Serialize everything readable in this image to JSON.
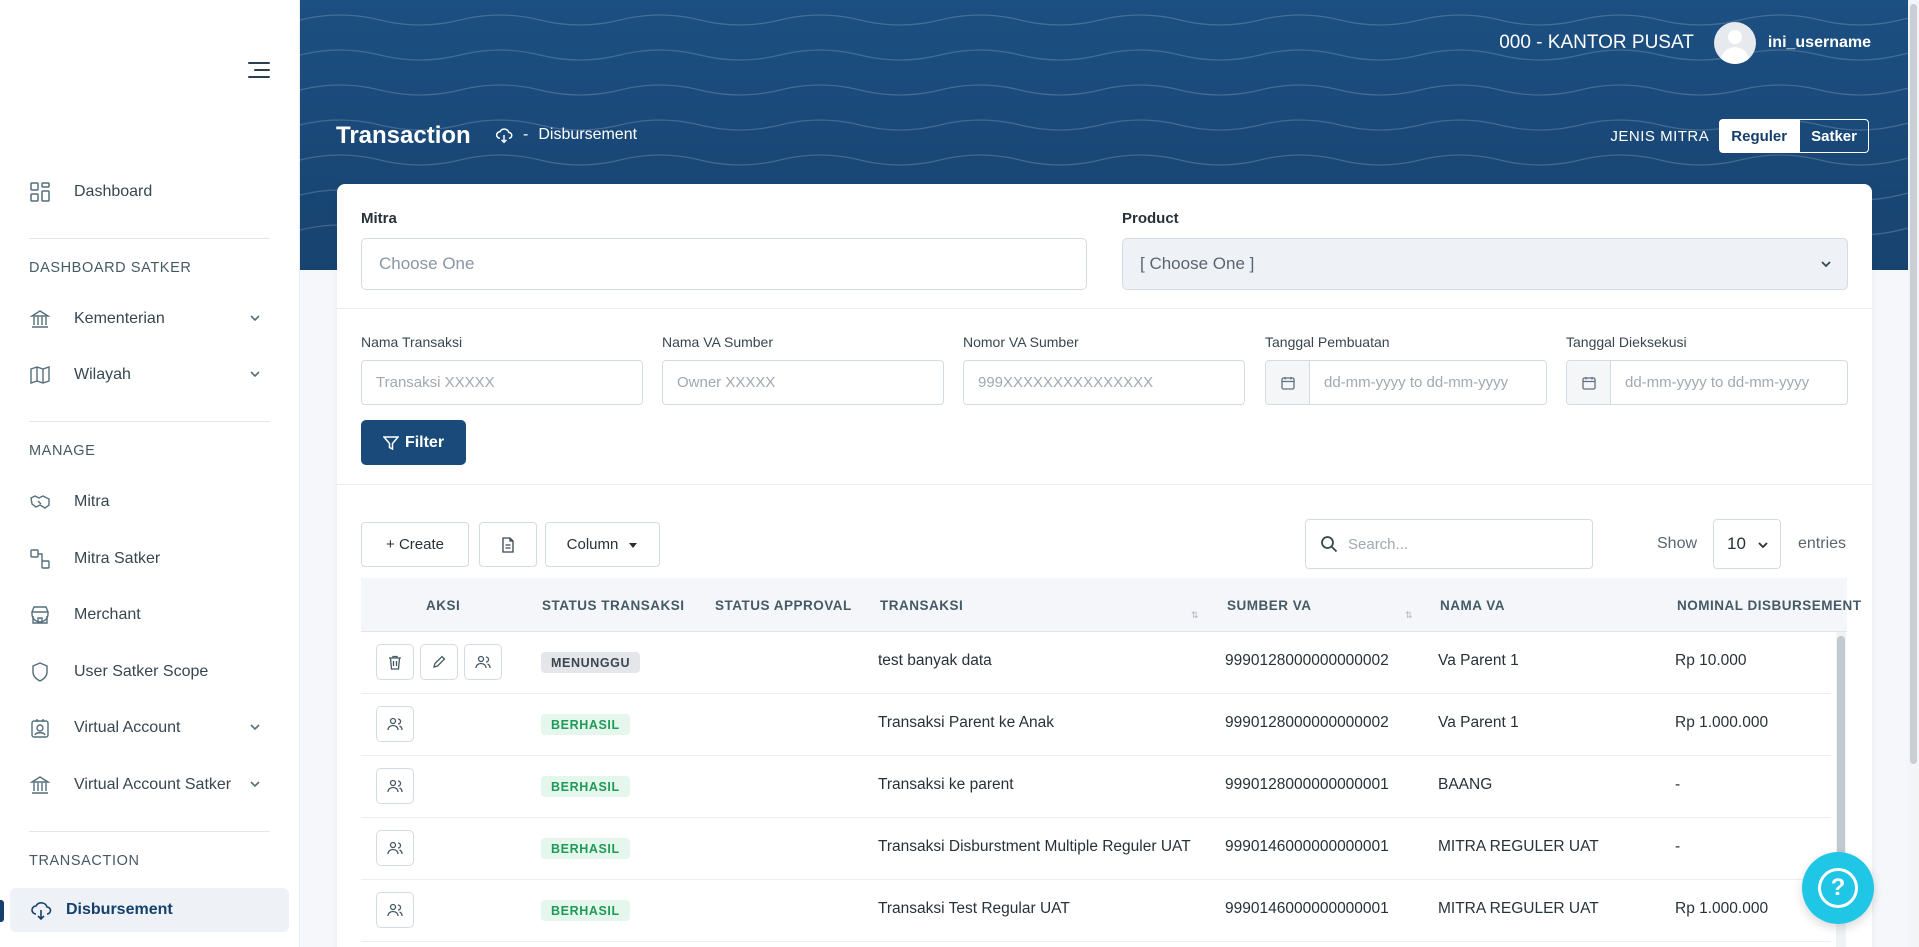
{
  "sidebar": {
    "items_top": [
      {
        "label": "Dashboard",
        "icon": "dashboard-icon"
      }
    ],
    "section_satker": "DASHBOARD SATKER",
    "satker_items": [
      {
        "label": "Kementerian",
        "icon": "bank-icon"
      },
      {
        "label": "Wilayah",
        "icon": "map-icon"
      }
    ],
    "section_manage": "MANAGE",
    "manage_items": [
      {
        "label": "Mitra",
        "icon": "handshake-icon"
      },
      {
        "label": "Mitra Satker",
        "icon": "link-icon"
      },
      {
        "label": "Merchant",
        "icon": "store-icon"
      },
      {
        "label": "User Satker Scope",
        "icon": "shield-icon"
      },
      {
        "label": "Virtual Account",
        "icon": "badge-icon"
      },
      {
        "label": "Virtual Account Satker",
        "icon": "bank-icon"
      }
    ],
    "section_transaction": "TRANSACTION",
    "transaction_items": [
      {
        "label": "Disbursement",
        "icon": "cloud-download-icon",
        "active": true
      }
    ]
  },
  "header": {
    "office": "000 - KANTOR PUSAT",
    "username": "ini_username",
    "page_title": "Transaction",
    "breadcrumb_sep": "-",
    "breadcrumb_current": "Disbursement",
    "jenis_label": "JENIS MITRA",
    "toggle_regular": "Reguler",
    "toggle_satker": "Satker"
  },
  "filters": {
    "mitra_label": "Mitra",
    "mitra_placeholder": "Choose One",
    "product_label": "Product",
    "product_value": "[ Choose One ]",
    "nama_transaksi_label": "Nama Transaksi",
    "nama_transaksi_placeholder": "Transaksi XXXXX",
    "nama_va_label": "Nama VA Sumber",
    "nama_va_placeholder": "Owner XXXXX",
    "nomor_va_label": "Nomor VA Sumber",
    "nomor_va_placeholder": "999XXXXXXXXXXXXXXX",
    "tgl_pembuatan_label": "Tanggal Pembuatan",
    "tgl_pembuatan_placeholder": "dd-mm-yyyy to dd-mm-yyyy",
    "tgl_eksekusi_label": "Tanggal Dieksekusi",
    "tgl_eksekusi_placeholder": "dd-mm-yyyy to dd-mm-yyyy",
    "filter_button": "Filter"
  },
  "toolbar": {
    "create_label": "+ Create",
    "column_label": "Column",
    "search_placeholder": "Search...",
    "show_label": "Show",
    "show_value": "10",
    "entries_label": "entries"
  },
  "table": {
    "columns": [
      "AKSI",
      "STATUS TRANSAKSI",
      "STATUS APPROVAL",
      "TRANSAKSI",
      "SUMBER VA",
      "NAMA VA",
      "NOMINAL DISBURSEMENT"
    ],
    "rows": [
      {
        "status": "MENUNGGU",
        "approval": "",
        "transaksi": "test banyak data",
        "sumber_va": "9990128000000000002",
        "nama_va": "Va Parent 1",
        "nominal": "Rp 10.000"
      },
      {
        "status": "BERHASIL",
        "approval": "",
        "transaksi": "Transaksi Parent ke Anak",
        "sumber_va": "9990128000000000002",
        "nama_va": "Va Parent 1",
        "nominal": "Rp 1.000.000"
      },
      {
        "status": "BERHASIL",
        "approval": "",
        "transaksi": "Transaksi ke parent",
        "sumber_va": "9990128000000000001",
        "nama_va": "BAANG",
        "nominal": "-"
      },
      {
        "status": "BERHASIL",
        "approval": "",
        "transaksi": "Transaksi Disburstment Multiple Reguler UAT",
        "sumber_va": "9990146000000000001",
        "nama_va": "MITRA REGULER UAT",
        "nominal": "-"
      },
      {
        "status": "BERHASIL",
        "approval": "",
        "transaksi": "Transaksi Test Regular UAT",
        "sumber_va": "9990146000000000001",
        "nama_va": "MITRA REGULER UAT",
        "nominal": "Rp 1.000.000"
      }
    ]
  },
  "help_symbol": "?",
  "colors": {
    "primary": "#1a4a7a",
    "header": "#1c4f82",
    "success": "#1e9b57",
    "help": "#1fc6e6"
  }
}
